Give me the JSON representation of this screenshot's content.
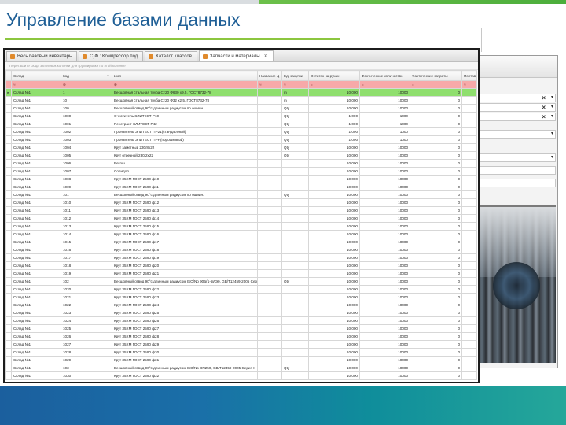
{
  "slide": {
    "title": "Управление базами данных"
  },
  "window": {
    "tabs": [
      {
        "label": "Весь базовый инвентарь"
      },
      {
        "label": "С)Ф : Компрессор под"
      },
      {
        "label": "Каталог классов"
      },
      {
        "label": "Запчасти и материалы"
      }
    ],
    "hint": "Перетащите сюда заголовок колонки для группировки по этой колонке"
  },
  "table": {
    "columns": [
      "Склад",
      "Код",
      "Имя",
      "Название Ц",
      "Ед. закупки",
      "Остаток на руках",
      "Фактическое количество",
      "Фактические затраты",
      "Поставщ"
    ],
    "rows": [
      {
        "warehouse": "Склад №1",
        "code": "1",
        "name": "Бесшовная стальная труба Ст20 Ф630 х9.5, ГОСТ8732-78",
        "unit": "m",
        "stock": "10 000",
        "qty": "10000",
        "cost": "0"
      },
      {
        "warehouse": "Склад №1",
        "code": "10",
        "name": "Бесшовная стальная труба Ст20 Ф32 х2.5, ГОСТ8732-78",
        "unit": "m",
        "stock": "10 000",
        "qty": "10000",
        "cost": "0"
      },
      {
        "warehouse": "Склад №1",
        "code": "100",
        "name": "Бесшовный отвод 90°с длинным радиусом по ошиин.",
        "unit": "Qty",
        "stock": "10 000",
        "qty": "10000",
        "cost": "0"
      },
      {
        "warehouse": "Склад №1",
        "code": "1000",
        "name": "Очиститель ЭЛИТЕСТ Р10",
        "unit": "Qty",
        "stock": "1 000",
        "qty": "1000",
        "cost": "0"
      },
      {
        "warehouse": "Склад №1",
        "code": "1001",
        "name": "Пенетрант ЭЛИТЕСТ Р42",
        "unit": "Qty",
        "stock": "1 000",
        "qty": "1000",
        "cost": "0"
      },
      {
        "warehouse": "Склад №1",
        "code": "1002",
        "name": "Проявитель ЭЛИТЕСТ ПР21(стандартный)",
        "unit": "Qty",
        "stock": "1 000",
        "qty": "1000",
        "cost": "0"
      },
      {
        "warehouse": "Склад №1",
        "code": "1003",
        "name": "Проявитель ЭЛИТЕСТ ПРН(порошковый)",
        "unit": "Qty",
        "stock": "1 000",
        "qty": "1000",
        "cost": "0"
      },
      {
        "warehouse": "Склад №1",
        "code": "1004",
        "name": "Круг заметный 230/8х22",
        "unit": "Qty",
        "stock": "10 000",
        "qty": "10000",
        "cost": "0"
      },
      {
        "warehouse": "Склад №1",
        "code": "1005",
        "name": "Круг отрезной 230/2х22",
        "unit": "Qty",
        "stock": "10 000",
        "qty": "10000",
        "cost": "0"
      },
      {
        "warehouse": "Склад №1",
        "code": "1006",
        "name": "Ветош",
        "unit": "",
        "stock": "10 000",
        "qty": "10000",
        "cost": "0"
      },
      {
        "warehouse": "Склад №1",
        "code": "1007",
        "name": "Солидол",
        "unit": "",
        "stock": "10 000",
        "qty": "10000",
        "cost": "0"
      },
      {
        "warehouse": "Склад №1",
        "code": "1008",
        "name": "Круг 35ХМ ГОСТ 2590 ф10",
        "unit": "",
        "stock": "10 000",
        "qty": "10000",
        "cost": "0"
      },
      {
        "warehouse": "Склад №1",
        "code": "1009",
        "name": "Круг 35ХМ ГОСТ 2590 ф11",
        "unit": "",
        "stock": "10 000",
        "qty": "10000",
        "cost": "0"
      },
      {
        "warehouse": "Склад №1",
        "code": "101",
        "name": "Бесшовный отвод 90°с длинным радиусом по ошиин.",
        "unit": "Qty",
        "stock": "10 000",
        "qty": "10000",
        "cost": "0"
      },
      {
        "warehouse": "Склад №1",
        "code": "1010",
        "name": "Круг 35ХМ ГОСТ 2590 ф12",
        "unit": "",
        "stock": "10 000",
        "qty": "10000",
        "cost": "0"
      },
      {
        "warehouse": "Склад №1",
        "code": "1011",
        "name": "Круг 35ХМ ГОСТ 2590 ф13",
        "unit": "",
        "stock": "10 000",
        "qty": "10000",
        "cost": "0"
      },
      {
        "warehouse": "Склад №1",
        "code": "1012",
        "name": "Круг 35ХМ ГОСТ 2590 ф14",
        "unit": "",
        "stock": "10 000",
        "qty": "10000",
        "cost": "0"
      },
      {
        "warehouse": "Склад №1",
        "code": "1013",
        "name": "Круг 35ХМ ГОСТ 2590 ф15",
        "unit": "",
        "stock": "10 000",
        "qty": "10000",
        "cost": "0"
      },
      {
        "warehouse": "Склад №1",
        "code": "1014",
        "name": "Круг 35ХМ ГОСТ 2590 ф16",
        "unit": "",
        "stock": "10 000",
        "qty": "10000",
        "cost": "0"
      },
      {
        "warehouse": "Склад №1",
        "code": "1015",
        "name": "Круг 35ХМ ГОСТ 2590 ф17",
        "unit": "",
        "stock": "10 000",
        "qty": "10000",
        "cost": "0"
      },
      {
        "warehouse": "Склад №1",
        "code": "1016",
        "name": "Круг 35ХМ ГОСТ 2590 ф18",
        "unit": "",
        "stock": "10 000",
        "qty": "10000",
        "cost": "0"
      },
      {
        "warehouse": "Склад №1",
        "code": "1017",
        "name": "Круг 35ХМ ГОСТ 2590 ф19",
        "unit": "",
        "stock": "10 000",
        "qty": "10000",
        "cost": "0"
      },
      {
        "warehouse": "Склад №1",
        "code": "1018",
        "name": "Круг 35ХМ ГОСТ 2590 ф20",
        "unit": "",
        "stock": "10 000",
        "qty": "10000",
        "cost": "0"
      },
      {
        "warehouse": "Склад №1",
        "code": "1019",
        "name": "Круг 35ХМ ГОСТ 2590 ф21",
        "unit": "",
        "stock": "10 000",
        "qty": "10000",
        "cost": "0"
      },
      {
        "warehouse": "Склад №1",
        "code": "102",
        "name": "Бесшовный отвод 90°с длинным радиусом ISO/No 90Б(1-5ИЭ0, GB/T12459-2005 Сер...",
        "unit": "Qty",
        "stock": "10 000",
        "qty": "10000",
        "cost": "0"
      },
      {
        "warehouse": "Склад №1",
        "code": "1020",
        "name": "Круг 35ХМ ГОСТ 2590 ф22",
        "unit": "",
        "stock": "10 000",
        "qty": "10000",
        "cost": "0"
      },
      {
        "warehouse": "Склад №1",
        "code": "1021",
        "name": "Круг 35ХМ ГОСТ 2590 ф23",
        "unit": "",
        "stock": "10 000",
        "qty": "10000",
        "cost": "0"
      },
      {
        "warehouse": "Склад №1",
        "code": "1022",
        "name": "Круг 35ХМ ГОСТ 2590 ф24",
        "unit": "",
        "stock": "10 000",
        "qty": "10000",
        "cost": "0"
      },
      {
        "warehouse": "Склад №1",
        "code": "1023",
        "name": "Круг 35ХМ ГОСТ 2590 ф25",
        "unit": "",
        "stock": "10 000",
        "qty": "10000",
        "cost": "0"
      },
      {
        "warehouse": "Склад №1",
        "code": "1024",
        "name": "Круг 35ХМ ГОСТ 2590 ф26",
        "unit": "",
        "stock": "10 000",
        "qty": "10000",
        "cost": "0"
      },
      {
        "warehouse": "Склад №1",
        "code": "1025",
        "name": "Круг 35ХМ ГОСТ 2590 ф27",
        "unit": "",
        "stock": "10 000",
        "qty": "10000",
        "cost": "0"
      },
      {
        "warehouse": "Склад №1",
        "code": "1026",
        "name": "Круг 35ХМ ГОСТ 2590 ф28",
        "unit": "",
        "stock": "10 000",
        "qty": "10000",
        "cost": "0"
      },
      {
        "warehouse": "Склад №1",
        "code": "1027",
        "name": "Круг 35ХМ ГОСТ 2590 ф29",
        "unit": "",
        "stock": "10 000",
        "qty": "10000",
        "cost": "0"
      },
      {
        "warehouse": "Склад №1",
        "code": "1028",
        "name": "Круг 35ХМ ГОСТ 2590 ф30",
        "unit": "",
        "stock": "10 000",
        "qty": "10000",
        "cost": "0"
      },
      {
        "warehouse": "Склад №1",
        "code": "1029",
        "name": "Круг 35ХМ ГОСТ 2590 ф31",
        "unit": "",
        "stock": "10 000",
        "qty": "10000",
        "cost": "0"
      },
      {
        "warehouse": "Склад №1",
        "code": "103",
        "name": "Бесшовный отвод 90°с длинным радиусом ISO/No DN250, GB/T12459-2005 Серия II",
        "unit": "Qty",
        "stock": "10 000",
        "qty": "10000",
        "cost": "0"
      },
      {
        "warehouse": "Склад №1",
        "code": "1030",
        "name": "Круг 35ХМ ГОСТ 2590 ф32",
        "unit": "",
        "stock": "10 000",
        "qty": "10000",
        "cost": "0"
      }
    ]
  },
  "colors": {
    "title": "#1f5f96",
    "accent_green": "#8cc63f",
    "selected_row": "#8fdf6e",
    "filter_row": "#f7a9a9"
  }
}
